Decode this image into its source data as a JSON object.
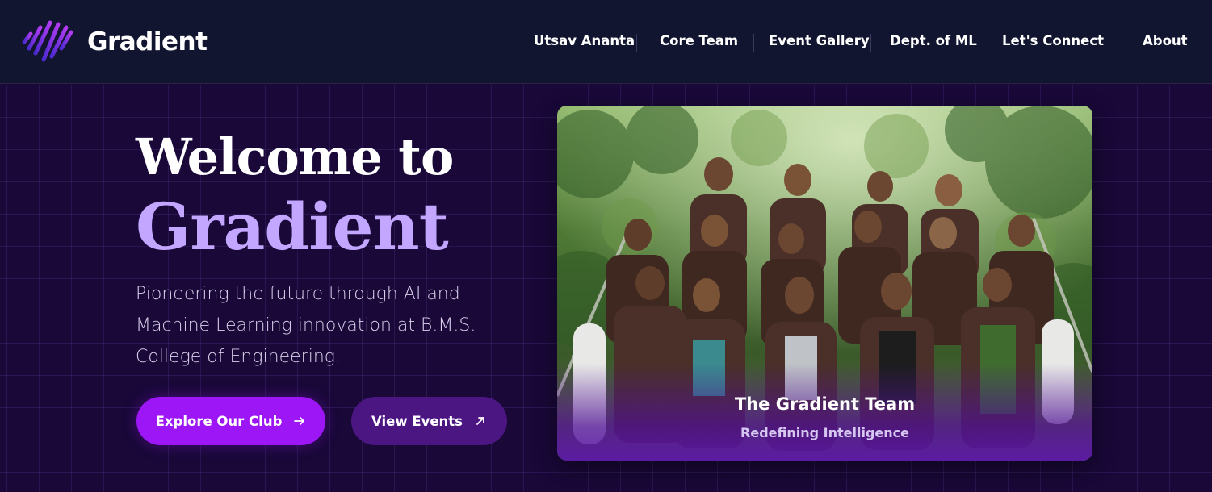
{
  "brand": {
    "name": "Gradient",
    "logo_icon": "wave-lines-icon",
    "accent_gradient": [
      "#5b2bd9",
      "#b03cf2"
    ]
  },
  "nav": {
    "items": [
      {
        "label": "Utsav Ananta"
      },
      {
        "label": "Core Team"
      },
      {
        "label": "Event Gallery"
      },
      {
        "label": "Dept. of ML"
      },
      {
        "label": "Let's Connect"
      },
      {
        "label": "About"
      }
    ]
  },
  "hero": {
    "title_line1": "Welcome to",
    "title_line2": "Gradient",
    "description": "Pioneering the future through AI and Machine Learning innovation at B.M.S. College of Engineering.",
    "primary_button": {
      "label": "Explore Our Club",
      "icon": "arrow-right-icon"
    },
    "secondary_button": {
      "label": "View Events",
      "icon": "arrow-up-right-icon"
    }
  },
  "photo_card": {
    "caption": "The Gradient Team",
    "subcaption": "Redefining Intelligence"
  },
  "colors": {
    "background": "#190838",
    "navbar": "#121530",
    "title_accent": "#c3a6ff",
    "primary_button": "#9d16f5",
    "secondary_button": "#4c1682"
  }
}
